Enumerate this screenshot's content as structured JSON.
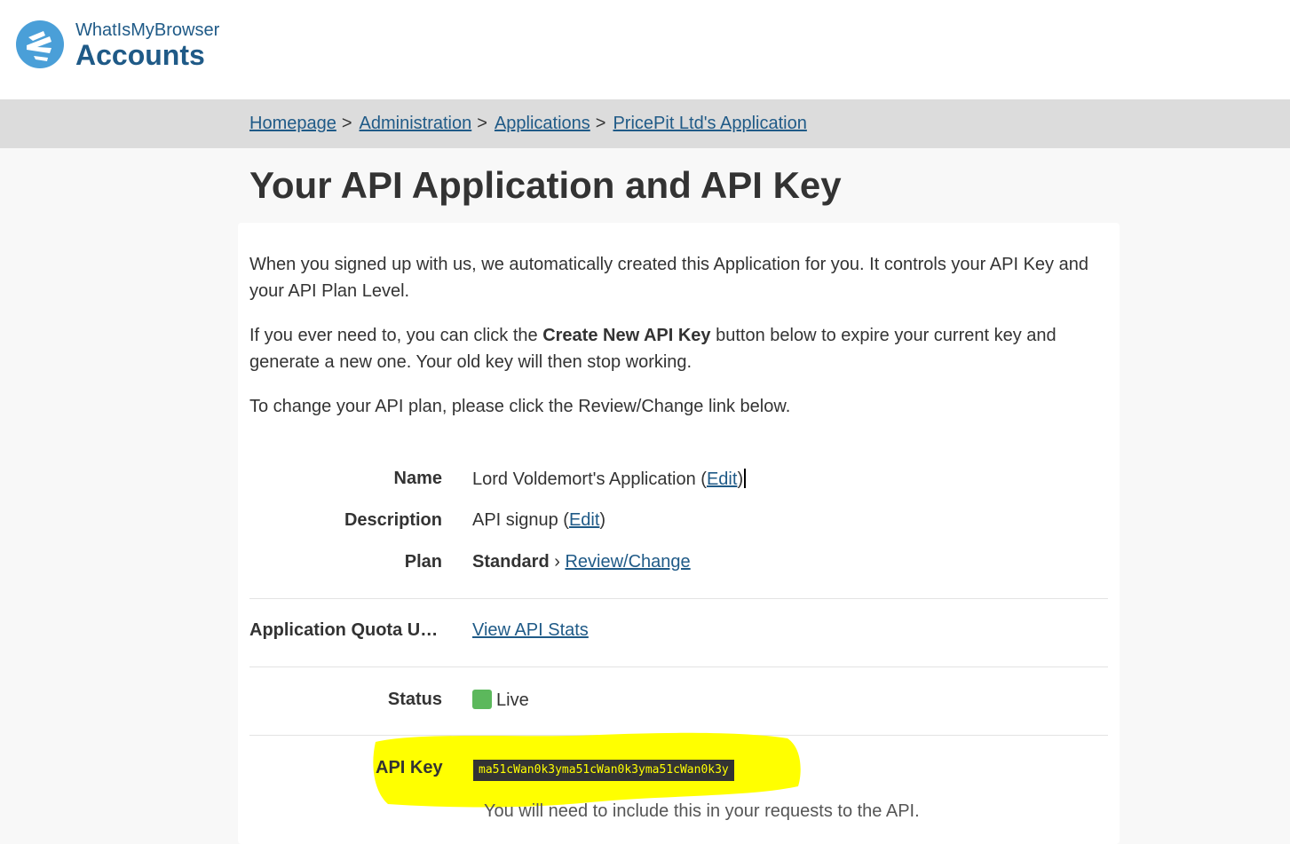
{
  "header": {
    "brand_small": "WhatIsMyBrowser",
    "brand_big": "Accounts",
    "logo_icon": "whatismybrowser-logo-icon",
    "brand_color": "#1f5a87"
  },
  "breadcrumb": {
    "items": [
      "Homepage",
      "Administration",
      "Applications",
      "PricePit Ltd's Application"
    ],
    "separator": ">"
  },
  "page": {
    "title": "Your API Application and API Key",
    "intro_1": "When you signed up with us, we automatically created this Application for you. It controls your API Key and your API Plan Level.",
    "intro_2_before": "If you ever need to, you can click the ",
    "intro_2_bold": "Create New API Key",
    "intro_2_after": " button below to expire your current key and generate a new one. Your old key will then stop working.",
    "intro_3": "To change your API plan, please click the Review/Change link below."
  },
  "details": {
    "name": {
      "label": "Name",
      "value": "Lord Voldemort's Application",
      "paren_open": " (",
      "edit": "Edit",
      "paren_close": ")"
    },
    "description": {
      "label": "Description",
      "value": "API signup",
      "paren_open": " (",
      "edit": "Edit",
      "paren_close": ")"
    },
    "plan": {
      "label": "Plan",
      "value": "Standard",
      "chevron": " › ",
      "link": "Review/Change"
    },
    "quota": {
      "label": "Application Quota U…",
      "link": "View API Stats"
    },
    "status": {
      "label": "Status",
      "value": "Live",
      "color": "#5cb85c"
    },
    "api_key": {
      "label": "API Key",
      "value": "ma51cWan0k3yma51cWan0k3yma51cWan0k3y",
      "note": "You will need to include this in your requests to the API.",
      "highlight_color": "#ffff00"
    }
  }
}
